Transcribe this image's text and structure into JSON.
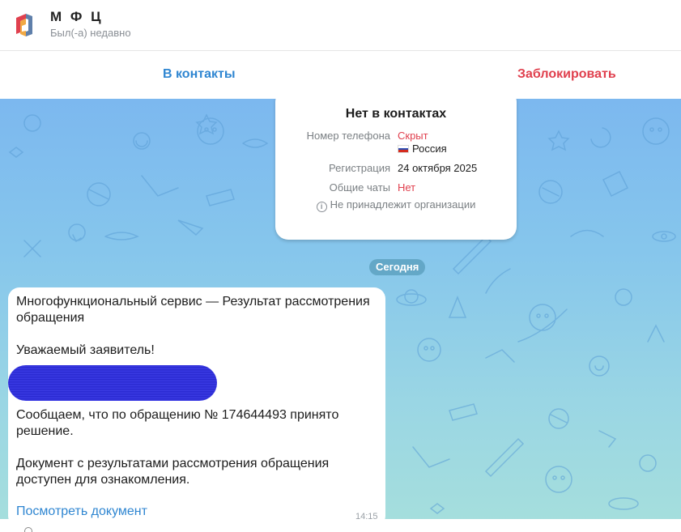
{
  "header": {
    "title": "М Ф Ц",
    "status": "Был(-а) недавно",
    "logo_icon": "mfc-logo-icon",
    "logo_colors": [
      "#e0404e",
      "#f0a030",
      "#5f7faa"
    ]
  },
  "actions": {
    "add_contact": "В контакты",
    "block": "Заблокировать"
  },
  "info_card": {
    "title": "Нет в контактах",
    "rows": [
      {
        "label": "Номер телефона",
        "value": "Скрыт",
        "value_color": "#e0404e"
      },
      {
        "label": "",
        "value": "Россия",
        "icon": "russia-flag-icon"
      },
      {
        "label": "Регистрация",
        "value": "24 октября 2025"
      },
      {
        "label": "Общие чаты",
        "value": "Нет",
        "value_color": "#e0404e"
      }
    ],
    "note": "Не принадлежит организации",
    "note_icon": "info-icon"
  },
  "date_separator": "Сегодня",
  "message": {
    "lines": [
      "Многофункциональный сервис — Результат рассмотрения",
      "обращения",
      "Уважаемый заявитель!",
      "Сообщаем, что по обращению № 174644493 принято",
      "решение.",
      "Документ с результатами рассмотрения обращения",
      "доступен для ознакомления."
    ],
    "link": "Посмотреть документ",
    "time": "14:15"
  },
  "colors": {
    "accent": "#2f86d1",
    "danger": "#e0404e",
    "chat_bg_top": "#7cb8ef",
    "chat_bg_bottom": "#a6dfdc"
  }
}
